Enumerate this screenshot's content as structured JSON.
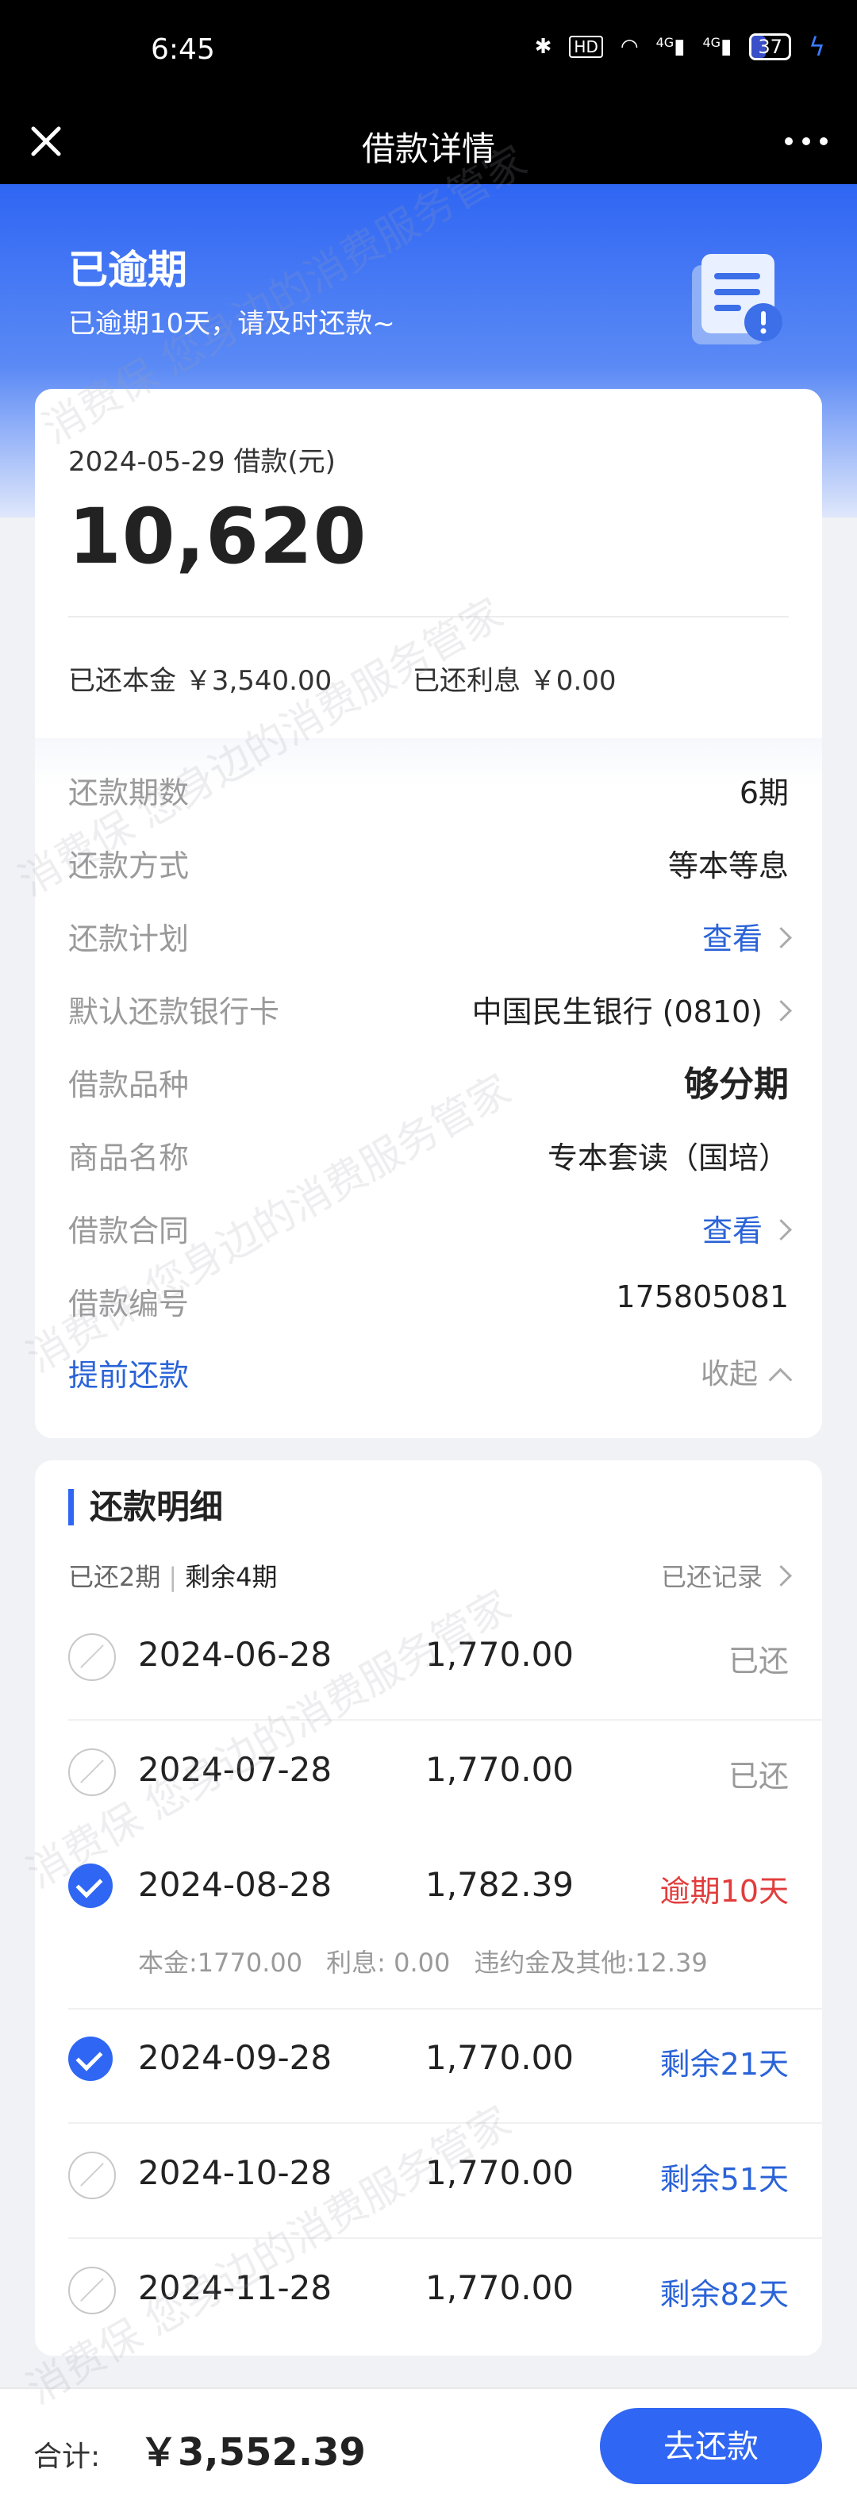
{
  "status_bar": {
    "time": "6:45",
    "hd_label": "HD",
    "net1": "4G",
    "net2": "4G",
    "battery": "37",
    "battery_fraction": 0.37
  },
  "nav": {
    "title": "借款详情"
  },
  "hero": {
    "title": "已逾期",
    "subtitle": "已逾期10天，请及时还款~"
  },
  "loan": {
    "date_line": "2024-05-29 借款(元)",
    "amount": "10,620",
    "principal_repaid": "已还本金 ￥3,540.00",
    "interest_repaid": "已还利息 ￥0.00"
  },
  "details": [
    {
      "label": "还款期数",
      "value": "6期"
    },
    {
      "label": "还款方式",
      "value": "等本等息"
    },
    {
      "label": "还款计划",
      "value": "查看"
    },
    {
      "label": "默认还款银行卡",
      "value": "中国民生银行 (0810)"
    },
    {
      "label": "借款品种",
      "value": "够分期"
    },
    {
      "label": "商品名称",
      "value": "专本套读（国培）"
    },
    {
      "label": "借款合同",
      "value": "查看"
    },
    {
      "label": "借款编号",
      "value": "175805081"
    }
  ],
  "actions": {
    "prepay": "提前还款",
    "collapse": "收起"
  },
  "schedule": {
    "title": "还款明细",
    "paid_count": "已还2期",
    "remaining_count": "剩余4期",
    "history": "已还记录",
    "installments": [
      {
        "date": "2024-06-28",
        "amount": "1,770.00",
        "status": "已还"
      },
      {
        "date": "2024-07-28",
        "amount": "1,770.00",
        "status": "已还"
      },
      {
        "date": "2024-08-28",
        "amount": "1,782.39",
        "status": "逾期10天"
      },
      {
        "date": "2024-09-28",
        "amount": "1,770.00",
        "status": "剩余21天"
      },
      {
        "date": "2024-10-28",
        "amount": "1,770.00",
        "status": "剩余51天"
      },
      {
        "date": "2024-11-28",
        "amount": "1,770.00",
        "status": "剩余82天"
      }
    ],
    "breakdown": {
      "principal": "本金:1770.00",
      "interest": "利息: 0.00",
      "penalty": "违约金及其他:12.39"
    }
  },
  "footer": {
    "total_label": "合计:",
    "total_value": "￥3,552.39",
    "pay_button": "去还款"
  },
  "watermark": "消费保 您身边的消费服务管家",
  "colors": {
    "accent": "#2f66f3",
    "overdue": "#e23c3c",
    "link": "#2a63d8"
  }
}
